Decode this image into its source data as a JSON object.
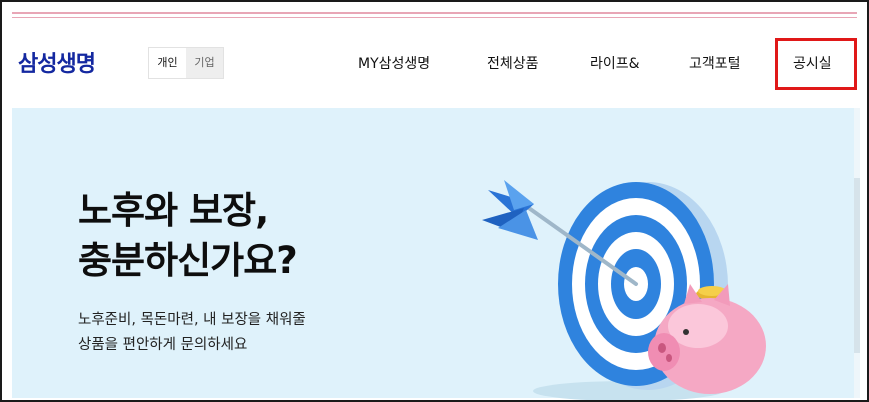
{
  "header": {
    "logo": "삼성생명",
    "segment": {
      "personal": "개인",
      "business": "기업"
    },
    "nav": [
      "MY삼성생명",
      "전체상품",
      "라이프&",
      "고객포털",
      "공시실"
    ]
  },
  "hero": {
    "headline_line1": "노후와 보장,",
    "headline_line2": "충분하신가요?",
    "sub_line1": "노후준비, 목돈마련, 내 보장을 채워줄",
    "sub_line2": "상품을 편안하게 문의하세요"
  },
  "colors": {
    "brand": "#1428a0",
    "highlight": "#e01818",
    "hero_bg": "#dff2fb"
  }
}
